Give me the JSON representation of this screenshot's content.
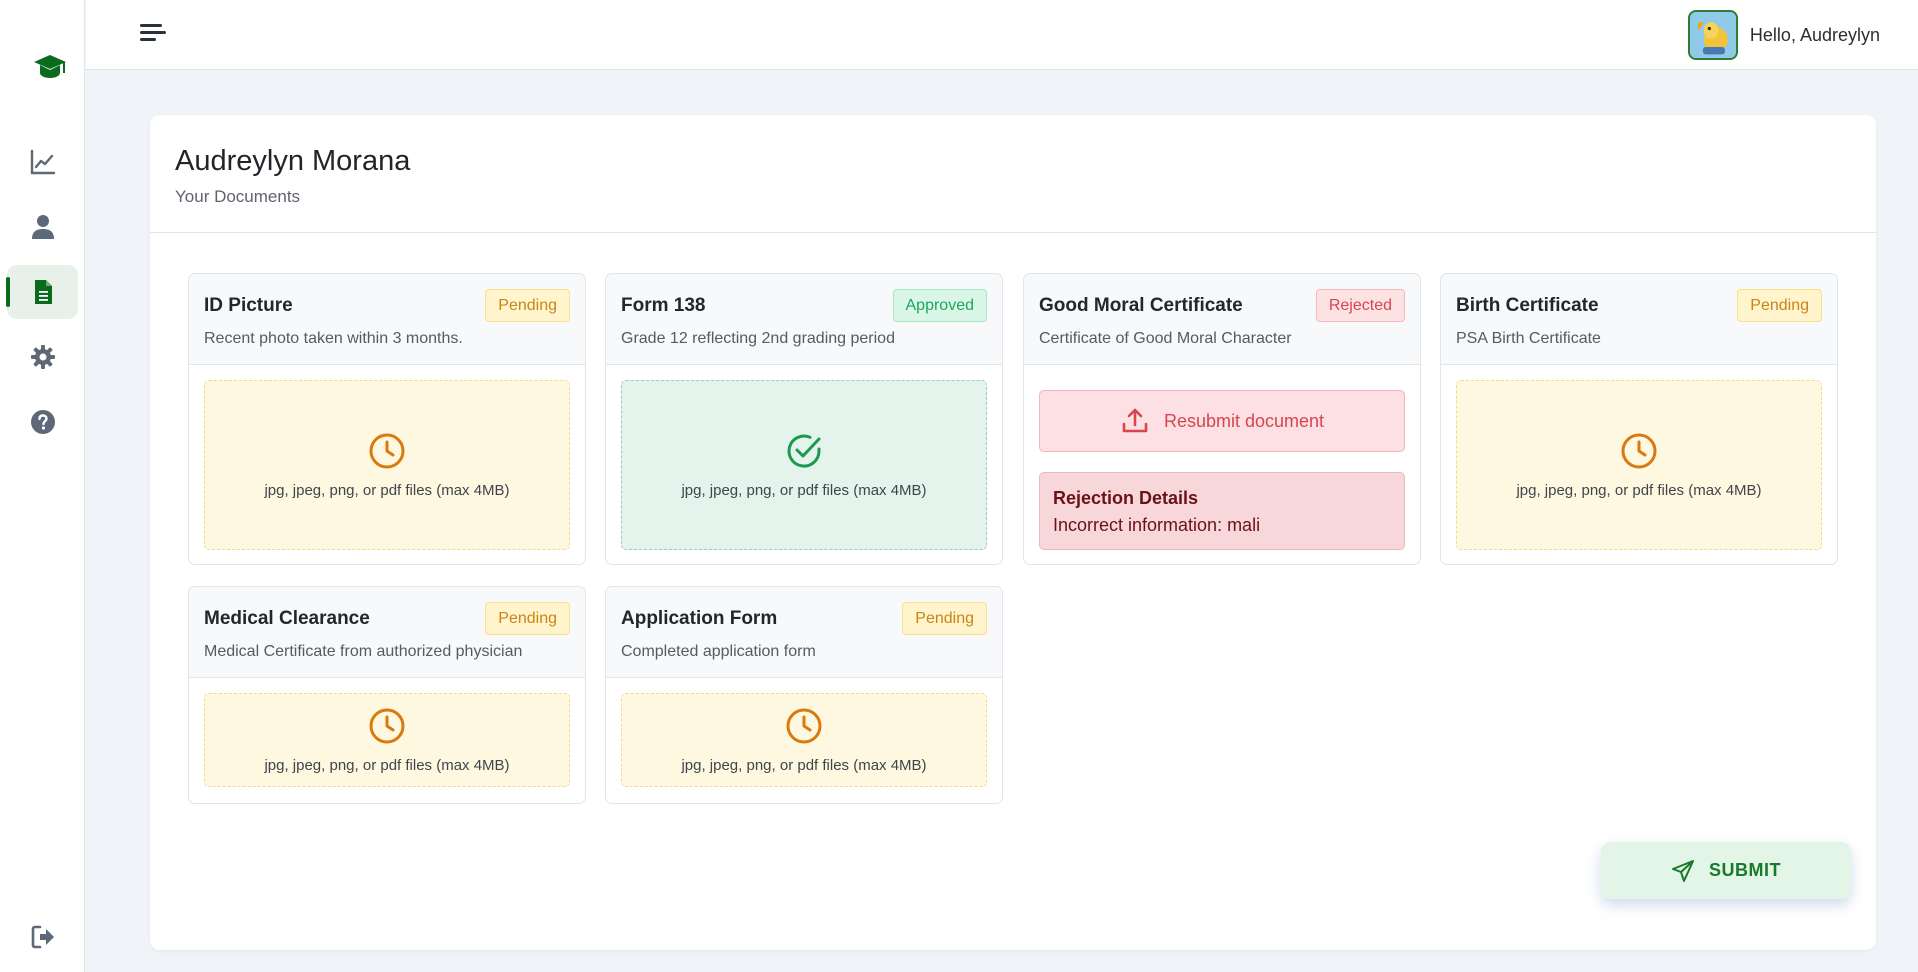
{
  "header": {
    "greeting": "Hello, Audreylyn"
  },
  "page": {
    "student_name": "Audreylyn Morana",
    "subtitle": "Your Documents"
  },
  "sidebar": {
    "items": [
      {
        "icon": "chart-line-icon"
      },
      {
        "icon": "user-icon"
      },
      {
        "icon": "file-icon",
        "active": true
      },
      {
        "icon": "gear-icon"
      },
      {
        "icon": "question-circle-icon"
      }
    ],
    "logout_icon": "sign-out-icon"
  },
  "documents": [
    {
      "title": "ID Picture",
      "description": "Recent photo taken within 3 months.",
      "status": "Pending",
      "file_hint": "jpg, jpeg, png, or pdf files (max 4MB)"
    },
    {
      "title": "Form 138",
      "description": "Grade 12 reflecting 2nd grading period",
      "status": "Approved",
      "file_hint": "jpg, jpeg, png, or pdf files (max 4MB)"
    },
    {
      "title": "Good Moral Certificate",
      "description": "Certificate of Good Moral Character",
      "status": "Rejected",
      "resubmit_label": "Resubmit document",
      "rejection_title": "Rejection Details",
      "rejection_text": "Incorrect information: mali"
    },
    {
      "title": "Birth Certificate",
      "description": "PSA Birth Certificate",
      "status": "Pending",
      "file_hint": "jpg, jpeg, png, or pdf files (max 4MB)"
    },
    {
      "title": "Medical Clearance",
      "description": "Medical Certificate from authorized physician",
      "status": "Pending",
      "file_hint": "jpg, jpeg, png, or pdf files (max 4MB)"
    },
    {
      "title": "Application Form",
      "description": "Completed application form",
      "status": "Pending",
      "file_hint": "jpg, jpeg, png, or pdf files (max 4MB)"
    }
  ],
  "submit_label": "SUBMIT",
  "colors": {
    "brand": "#0b6b1d",
    "pending": "#d9790e",
    "approved": "#1ca65e",
    "rejected": "#d7454f",
    "sidebar_icon": "#5d6878"
  }
}
